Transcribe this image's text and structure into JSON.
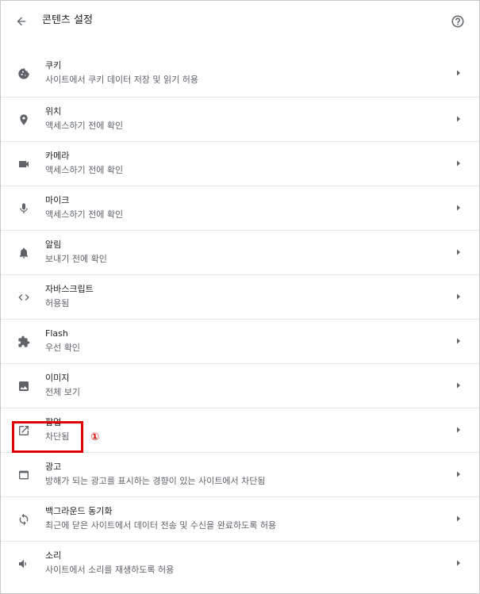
{
  "header": {
    "title": "콘텐츠 설정",
    "back_icon": "arrow-left-icon",
    "help_icon": "help-circle-icon"
  },
  "rows": [
    {
      "key": "cookies",
      "icon": "cookie-icon",
      "title": "쿠키",
      "subtitle": "사이트에서 쿠키 데이터 저장 및 읽기 허용"
    },
    {
      "key": "location",
      "icon": "location-pin-icon",
      "title": "위치",
      "subtitle": "액세스하기 전에 확인"
    },
    {
      "key": "camera",
      "icon": "video-camera-icon",
      "title": "카메라",
      "subtitle": "액세스하기 전에 확인"
    },
    {
      "key": "microphone",
      "icon": "microphone-icon",
      "title": "마이크",
      "subtitle": "액세스하기 전에 확인"
    },
    {
      "key": "notifications",
      "icon": "bell-icon",
      "title": "알림",
      "subtitle": "보내기 전에 확인"
    },
    {
      "key": "javascript",
      "icon": "code-brackets-icon",
      "title": "자바스크립트",
      "subtitle": "허용됨"
    },
    {
      "key": "flash",
      "icon": "puzzle-piece-icon",
      "title": "Flash",
      "subtitle": "우선 확인"
    },
    {
      "key": "images",
      "icon": "image-icon",
      "title": "이미지",
      "subtitle": "전체 보기"
    },
    {
      "key": "popups",
      "icon": "open-in-new-icon",
      "title": "팝업",
      "subtitle": "차단됨"
    },
    {
      "key": "ads",
      "icon": "browser-window-icon",
      "title": "광고",
      "subtitle": "방해가 되는 광고를 표시하는 경향이 있는 사이트에서 차단됨"
    },
    {
      "key": "background-sync",
      "icon": "sync-icon",
      "title": "백그라운드 동기화",
      "subtitle": "최근에 닫은 사이트에서 데이터 전송 및 수신을 완료하도록 허용"
    },
    {
      "key": "sound",
      "icon": "speaker-icon",
      "title": "소리",
      "subtitle": "사이트에서 소리를 재생하도록 허용"
    }
  ],
  "annotation": {
    "label": "①",
    "color": "#e00000"
  },
  "colors": {
    "icon": "#5f6368",
    "title": "#202124",
    "subtitle": "#5f6368",
    "divider": "#e8e8e8"
  }
}
